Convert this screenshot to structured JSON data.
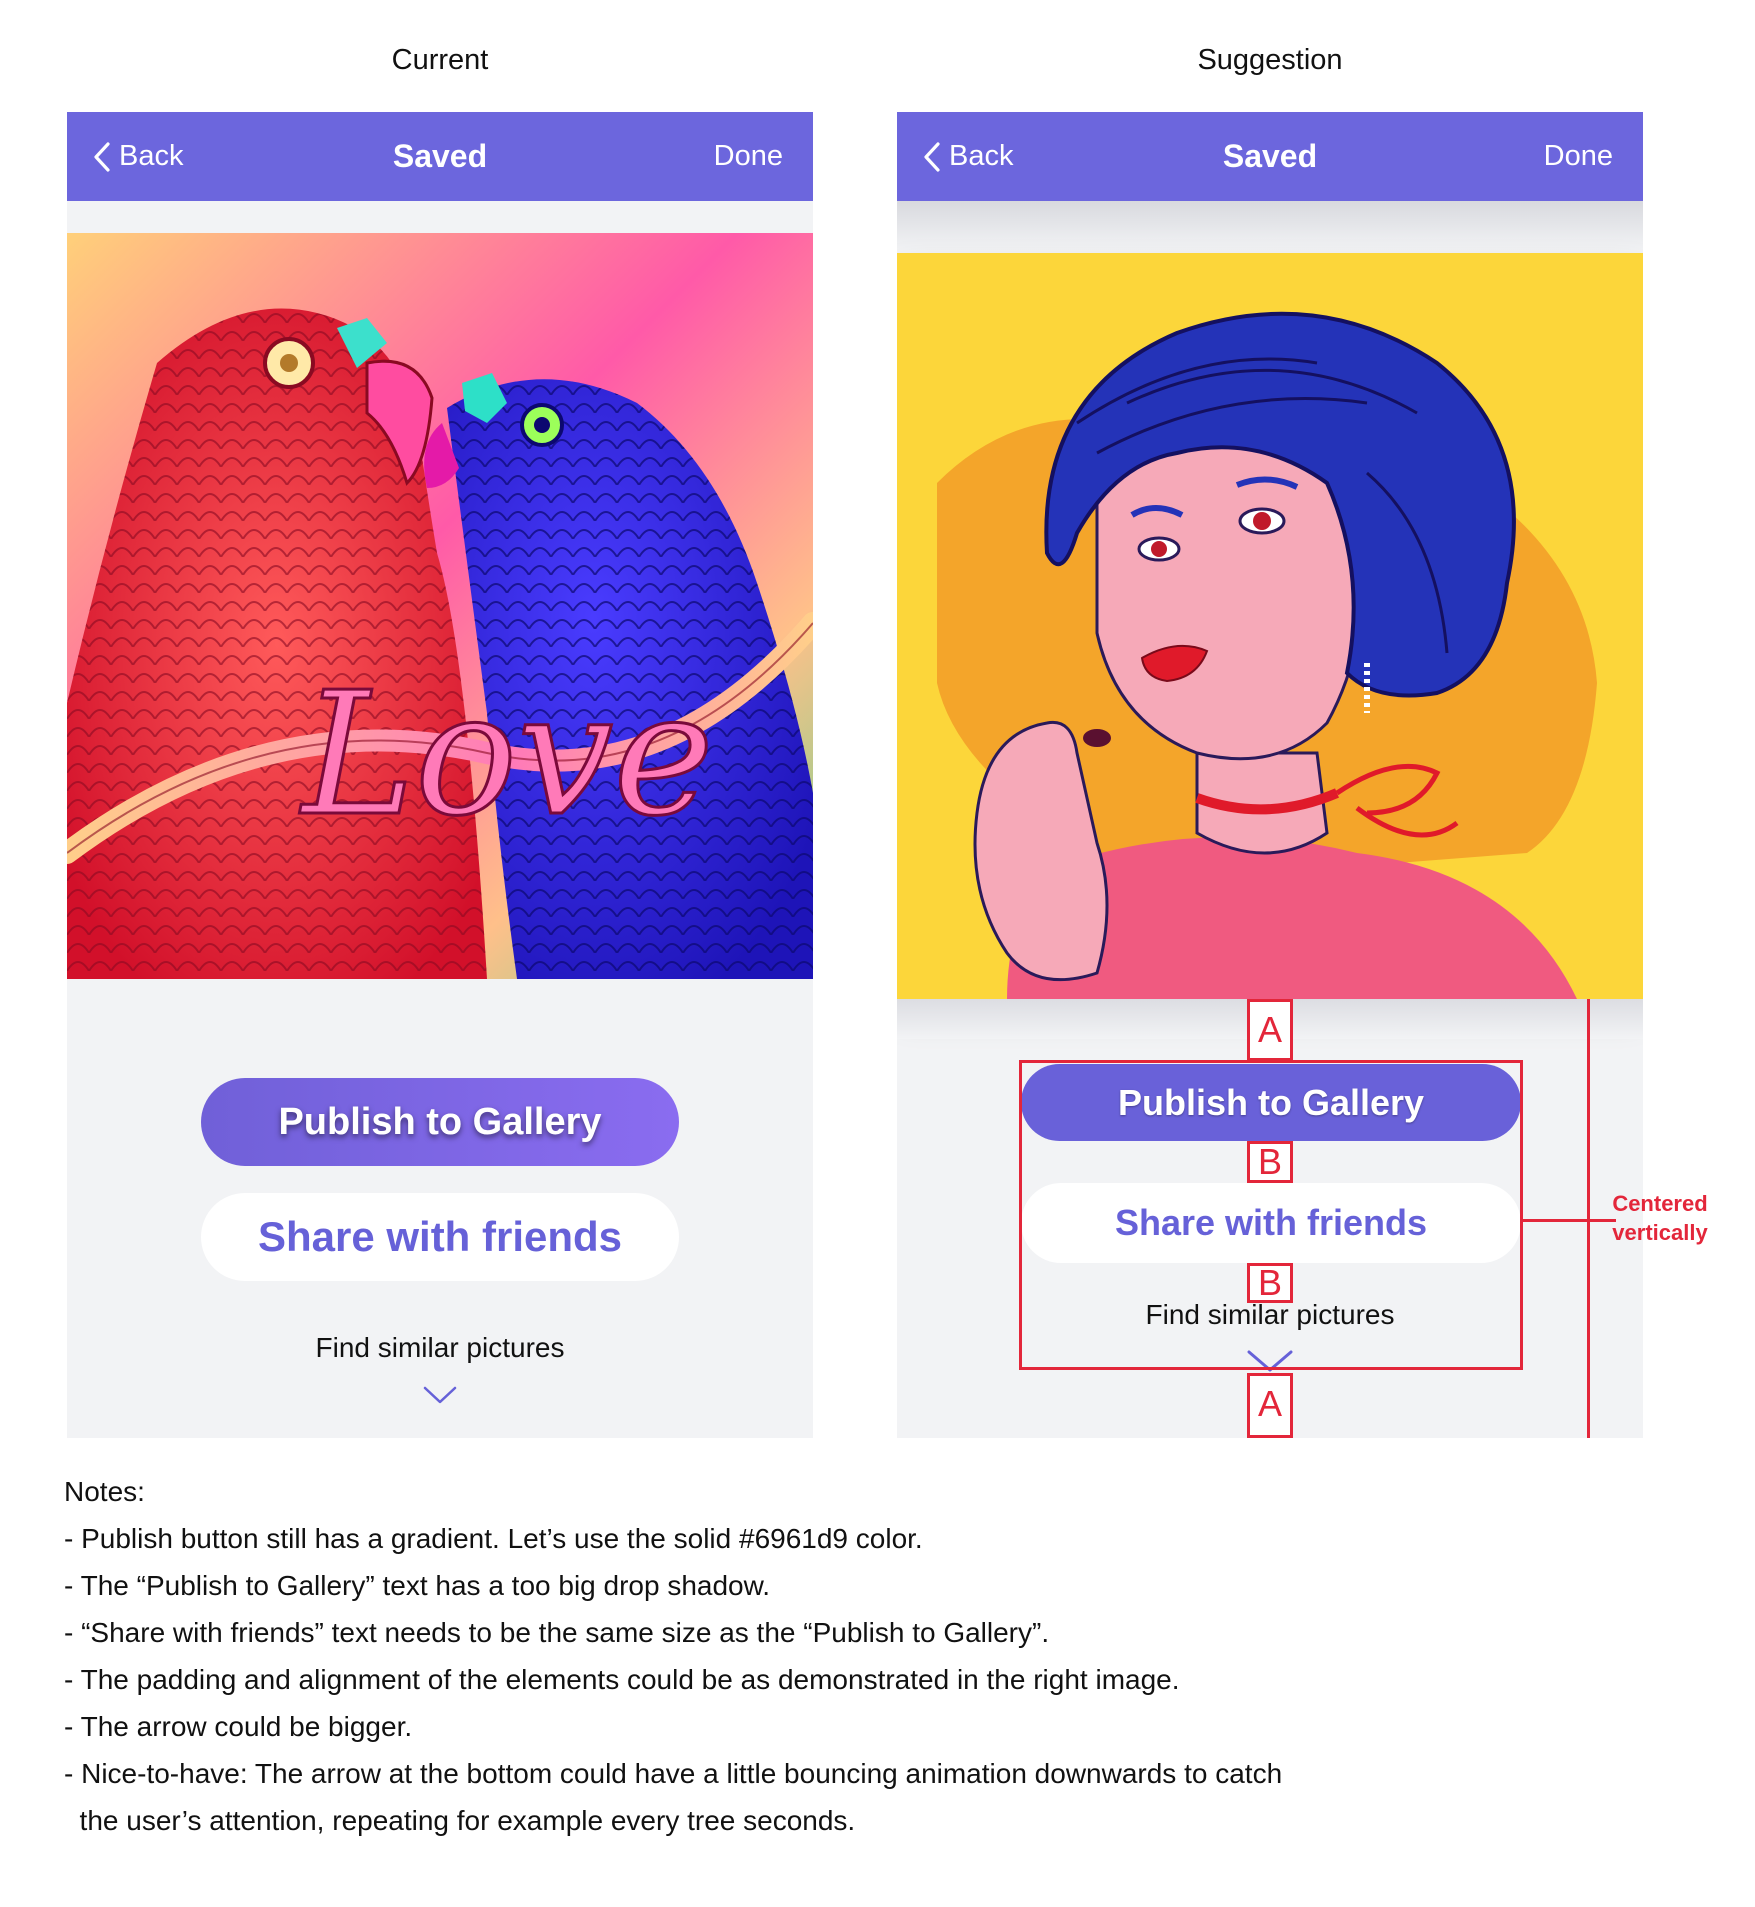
{
  "current": {
    "column_title": "Current",
    "nav": {
      "back_label": "Back",
      "title": "Saved",
      "done_label": "Done"
    },
    "publish_label": "Publish to Gallery",
    "share_label": "Share with friends",
    "find_label": "Find similar pictures",
    "artwork_text": "Love"
  },
  "suggestion": {
    "column_title": "Suggestion",
    "nav": {
      "back_label": "Back",
      "title": "Saved",
      "done_label": "Done"
    },
    "publish_label": "Publish to Gallery",
    "share_label": "Share with friends",
    "find_label": "Find similar pictures",
    "annotations": {
      "label_a": "A",
      "label_b": "B",
      "centered_line1": "Centered",
      "centered_line2": "vertically"
    }
  },
  "colors": {
    "navbar": "#6c66dd",
    "publish_solid": "#6961d9",
    "annotation": "#e3263a",
    "screen_bg": "#f2f3f5"
  },
  "notes": {
    "heading": "Notes:",
    "items": [
      "- Publish button still has a gradient. Let’s use the solid #6961d9 color.",
      "- The “Publish to Gallery” text has a too big drop shadow.",
      "- “Share with friends” text needs to be the same size as the “Publish to Gallery”.",
      "- The padding and alignment of the elements could be as demonstrated in the right image.",
      "- The arrow could be bigger.",
      "- Nice-to-have: The arrow at the bottom could have a little bouncing animation downwards to catch",
      "  the user’s attention, repeating for example every tree seconds."
    ]
  }
}
